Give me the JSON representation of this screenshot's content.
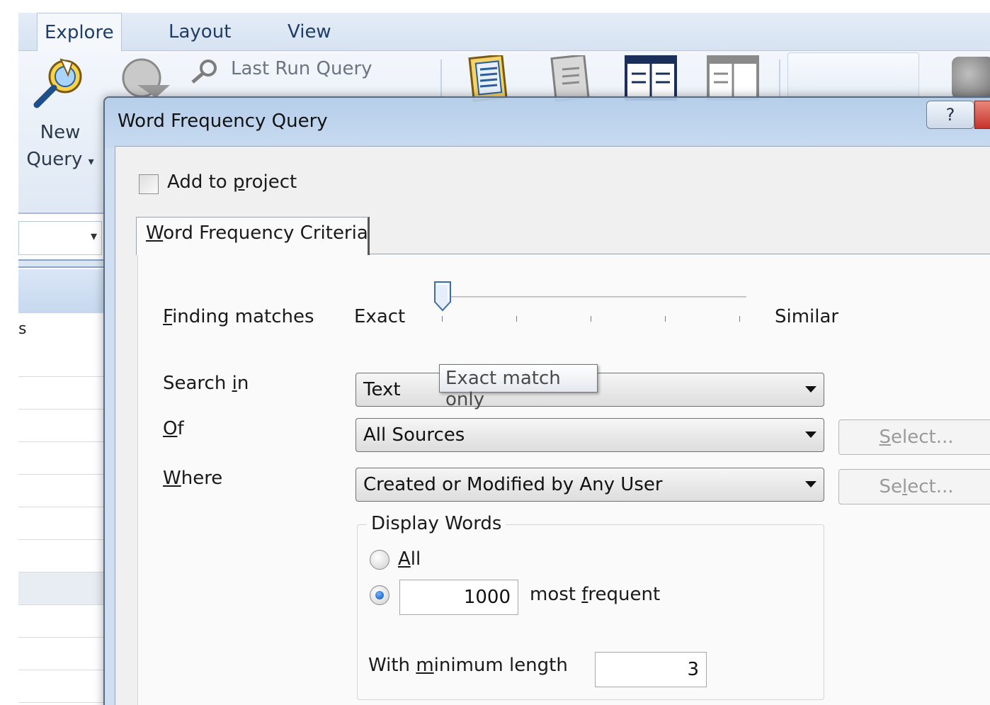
{
  "ribbon": {
    "tabs": [
      {
        "label": "Explore",
        "active": true
      },
      {
        "label": "Layout",
        "active": false
      },
      {
        "label": "View",
        "active": false
      }
    ],
    "new_query_label_line1": "New",
    "new_query_label_line2": "Query",
    "new_query_arrow": "▾",
    "last_run_query_label": "Last Run Query"
  },
  "left_panel": {
    "column_label": "s",
    "combo_arrow": "▾"
  },
  "dialog": {
    "title": "Word Frequency Query",
    "help_glyph": "?",
    "add_to_project": {
      "label_pre": "Add to ",
      "label_u": "p",
      "label_post": "roject",
      "checked": false
    },
    "tab": {
      "label_u": "W",
      "label_post": "ord Frequency Criteria"
    },
    "finding_matches": {
      "label_u": "F",
      "label_post": "inding matches",
      "min_label": "Exact",
      "max_label": "Similar",
      "slider_level": 0,
      "slider_steps": 5,
      "tooltip": "Exact match only"
    },
    "search_in": {
      "label_pre": "Search ",
      "label_u": "i",
      "label_post": "n",
      "value": "Text"
    },
    "of": {
      "label_u": "O",
      "label_post": "f",
      "value": "All Sources",
      "select_label_u": "S",
      "select_label_post": "elect..."
    },
    "where": {
      "label_u": "W",
      "label_post": "here",
      "value": "Created or Modified by Any User",
      "select_label_pre": "Se",
      "select_label_u": "l",
      "select_label_post": "ect..."
    },
    "display_words": {
      "title": "Display Words",
      "all_label_u": "A",
      "all_label_post": "ll",
      "all_selected": false,
      "most_frequent_selected": true,
      "most_frequent_value": "1000",
      "most_frequent_label_pre": "most ",
      "most_frequent_label_u": "f",
      "most_frequent_label_post": "requent",
      "min_length_label_pre": "With ",
      "min_length_label_u": "m",
      "min_length_label_post": "inimum length",
      "min_length_value": "3"
    }
  },
  "colors": {
    "accent": "#1f3d66",
    "dialog_frame": "#b2cbe8",
    "close_red": "#c6332a"
  }
}
